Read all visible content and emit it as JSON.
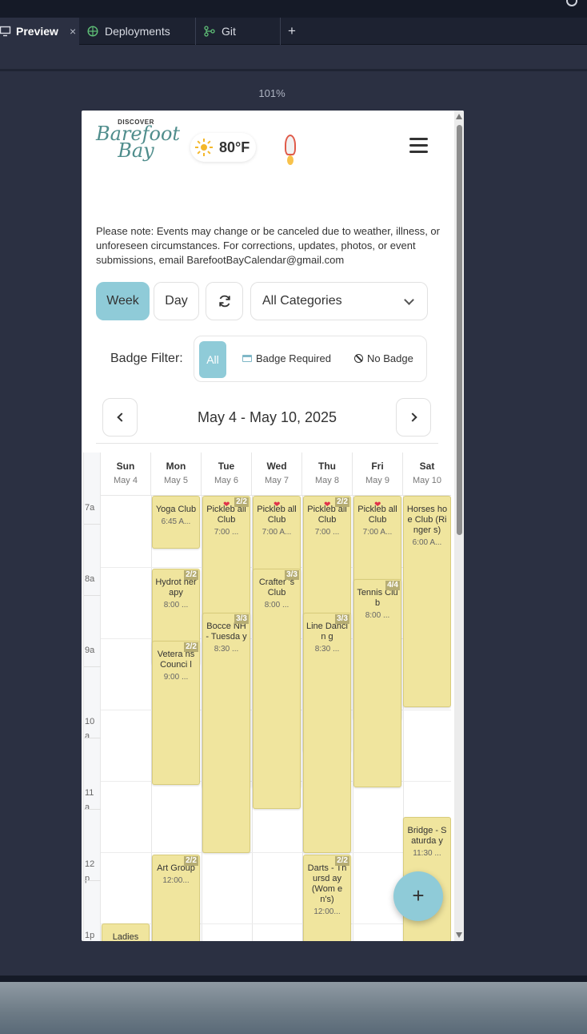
{
  "tabs": [
    {
      "label": "Preview",
      "close": "×",
      "icon": "monitor-icon"
    },
    {
      "label": "Deployments",
      "icon": "globe-icon"
    },
    {
      "label": "Git",
      "icon": "git-branch-icon"
    }
  ],
  "new_tab": "+",
  "zoom": "101%",
  "app": {
    "logo_top": "DISCOVER",
    "logo_line1": "Barefoot",
    "logo_line2": "Bay",
    "temperature": "80°F",
    "notice": "Please note: Events may change or be canceled due to weather, illness, or unforeseen circumstances. For corrections, updates, photos, or event submissions, email BarefootBayCalendar@gmail.com",
    "view_week": "Week",
    "view_day": "Day",
    "category_select": "All Categories",
    "badge_filter_label": "Badge Filter:",
    "badge_all": "All",
    "badge_required": "Badge Required",
    "badge_none": "No Badge",
    "date_range": "May 4 - May 10, 2025",
    "fab": "+"
  },
  "colors": {
    "accent": "#8fcbd8",
    "event_bg": "#f0e59e",
    "heart": "#e0334a"
  },
  "calendar": {
    "days": [
      {
        "name": "Sun",
        "date": "May 4"
      },
      {
        "name": "Mon",
        "date": "May 5"
      },
      {
        "name": "Tue",
        "date": "May 6"
      },
      {
        "name": "Wed",
        "date": "May 7"
      },
      {
        "name": "Thu",
        "date": "May 8"
      },
      {
        "name": "Fri",
        "date": "May 9"
      },
      {
        "name": "Sat",
        "date": "May 10"
      }
    ],
    "hours": [
      "7a",
      "8a",
      "9a",
      "10 a",
      "11 a",
      "12 p",
      "1p"
    ],
    "events": [
      {
        "title": "Yoga Club",
        "time": "6:45 A..."
      },
      {
        "title": "Hydrot herapy",
        "time": "8:00 ...",
        "count": "2/2"
      },
      {
        "title": "Vetera ns Counci l",
        "time": "9:00 ...",
        "count": "2/2"
      },
      {
        "title": "Art Group",
        "time": "12:00...",
        "count": "2/2"
      },
      {
        "title": "Pickleb all Club",
        "time": "7:00 ...",
        "count": "2/2"
      },
      {
        "title": "Bocce NH - Tuesda y",
        "time": "8:30 ...",
        "count": "3/3"
      },
      {
        "title": "Pickleb all Club",
        "time": "7:00 A..."
      },
      {
        "title": "Crafter 's Club",
        "time": "8:00 ...",
        "count": "3/3"
      },
      {
        "title": "Pickleb all Club",
        "time": "7:00 ...",
        "count": "2/2"
      },
      {
        "title": "Line Dancin g",
        "time": "8:30 ...",
        "count": "3/3"
      },
      {
        "title": "Darts - Thursd ay (Wom en's)",
        "time": "12:00...",
        "count": "2/2"
      },
      {
        "title": "Pickleb all Club",
        "time": "7:00 A..."
      },
      {
        "title": "Tennis Club",
        "time": "8:00 ...",
        "count": "4/4"
      },
      {
        "title": "Horses hoe Club (Ringer s)",
        "time": "6:00 A..."
      },
      {
        "title": "Bridge - Saturda y",
        "time": "11:30 ..."
      },
      {
        "title": "Ladies",
        "time": ""
      }
    ]
  }
}
